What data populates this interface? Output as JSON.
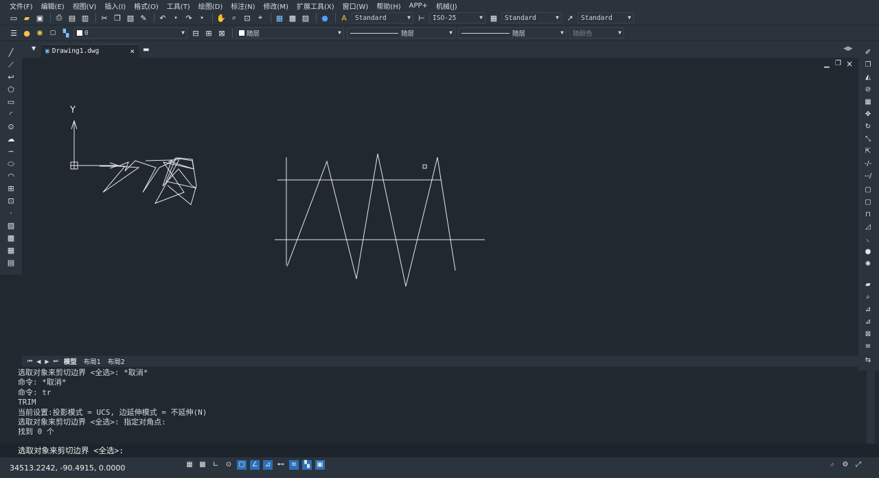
{
  "menu": [
    "文件(F)",
    "编辑(E)",
    "视图(V)",
    "插入(I)",
    "格式(O)",
    "工具(T)",
    "绘图(D)",
    "标注(N)",
    "修改(M)",
    "扩展工具(X)",
    "窗口(W)",
    "帮助(H)",
    "APP+",
    "机械(J)"
  ],
  "styles": {
    "text_style": "Standard",
    "dim_style": "ISO-25",
    "table_style": "Standard",
    "multileader_style": "Standard"
  },
  "layers": {
    "current_layer": "0",
    "color": "随层",
    "linetype": "随层",
    "lineweight": "随层",
    "plot_color": "随颜色"
  },
  "document": {
    "tab_name": "Drawing1.dwg",
    "ucs_y_label": "Y"
  },
  "layout_tabs": [
    "模型",
    "布局1",
    "布局2"
  ],
  "command_history": [
    "选取对象来剪切边界 <全选>: *取消*",
    "命令: *取消*",
    "命令: tr",
    "TRIM",
    "当前设置:投影模式 = UCS, 边延伸模式 = 不延伸(N)",
    "选取对象来剪切边界 <全选>: 指定对角点:",
    "找到 0 个"
  ],
  "command_prompt": "选取对象来剪切边界 <全选>:",
  "status": {
    "coordinates": "34513.2242, -90.4915, 0.0000"
  },
  "colors": {
    "background": "#212830",
    "panel": "#2b333d",
    "line": "#e6e9ec",
    "toggle_on": "#2d6fb8"
  }
}
